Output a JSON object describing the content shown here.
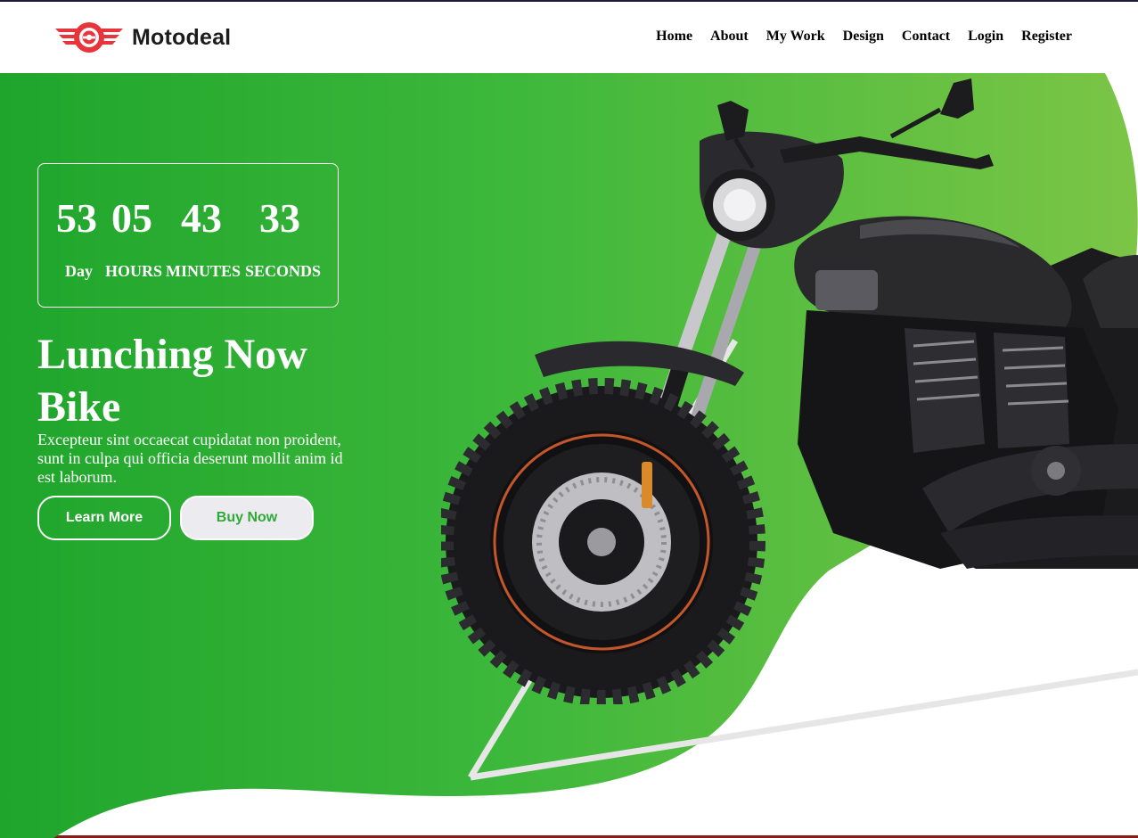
{
  "brand": {
    "name": "Motodeal",
    "logo_color": "#e8343a"
  },
  "nav": {
    "items": [
      "Home",
      "About",
      "My Work",
      "Design",
      "Contact",
      "Login",
      "Register"
    ]
  },
  "countdown": {
    "day_value": "53",
    "hours_value": "05",
    "minutes_value": "43",
    "seconds_value": "33",
    "day_label": "Day",
    "hours_label": "HOURS",
    "minutes_label": "MINUTES",
    "seconds_label": "SECONDS"
  },
  "hero": {
    "title_line1": "Lunching Now",
    "title_line2": "Bike",
    "description": "Excepteur sint occaecat cupidatat non proident, sunt in culpa qui officia deserunt mollit anim id est laborum.",
    "learn_more_label": "Learn More",
    "buy_now_label": "Buy Now"
  },
  "colors": {
    "green_dark": "#1fa52c",
    "green_light": "#7cc546",
    "buy_text": "#2faa36"
  }
}
